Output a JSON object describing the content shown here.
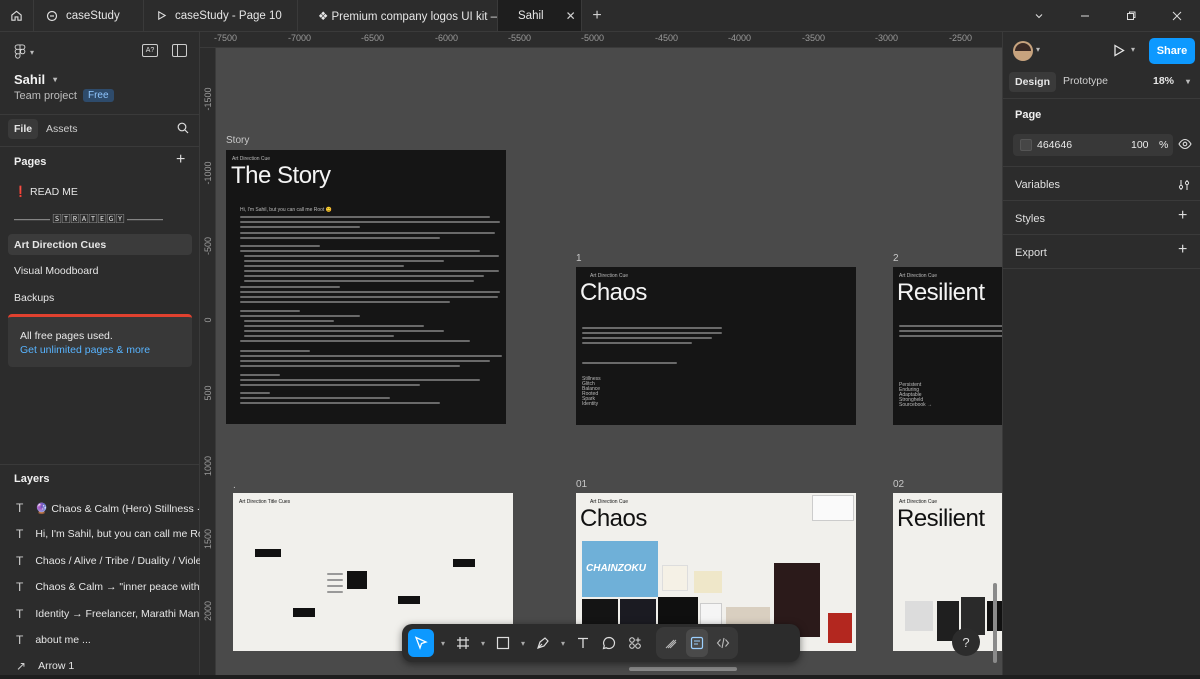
{
  "tabs": [
    {
      "label": "caseStudy",
      "icon": "figma-file-icon"
    },
    {
      "label": "caseStudy - Page 10",
      "icon": "play-icon"
    },
    {
      "label": "❖ Premium company logos UI kit – Un",
      "icon": "file-icon"
    },
    {
      "label": "Sahil",
      "icon": "file-icon",
      "close": "✕"
    }
  ],
  "left": {
    "project": "Sahil",
    "team": "Team project",
    "badge": "Free",
    "file_tab": "File",
    "assets_tab": "Assets",
    "pages_title": "Pages",
    "pages": [
      "❗ READ ME",
      "———— 🅂🅃🅁🄰🅃🄴🄶🅈 ————",
      "Art Direction Cues",
      "Visual Moodboard",
      "Backups"
    ],
    "banner_text": "All free pages used.",
    "banner_link": "Get unlimited pages & more",
    "layers_title": "Layers",
    "layers": [
      "🔮 Chaos & Calm (Hero) Stillness · Glit",
      "Hi, I'm Sahil, but you can call me Root",
      "Chaos / Alive / Tribe / Duality / Violenc",
      "Chaos & Calm → \"inner peace with cha",
      "Identity → Freelancer, Marathi Manus,",
      "about me ...",
      "Arrow 1"
    ]
  },
  "ruler": {
    "x": [
      "-7500",
      "-7000",
      "-6500",
      "-6000",
      "-5500",
      "-5000",
      "-4500",
      "-4000",
      "-3500",
      "-3000",
      "-2500"
    ],
    "y": [
      "-1500",
      "-1000",
      "-500",
      "0",
      "500",
      "1000",
      "1500",
      "2000"
    ]
  },
  "canvas": {
    "story_label": "Story",
    "cue": "Art Direction Cue",
    "story_title": "The Story",
    "greeting": "Hi, I'm Sahil, but you can call me Root 😊",
    "frame1_num": "1",
    "frame1_title": "Chaos",
    "frame2_num": "2",
    "frame2_title": "Resilient",
    "title_cues_label": "Art Direction Title Cues",
    "frame01_num": "01",
    "frame01_title": "Chaos",
    "frame02_num": "02",
    "frame02_title": "Resilient",
    "poster_text": "CHAINZOKU",
    "chaos_words": [
      "Stillness",
      "Glitch",
      "Balance",
      "Rooted",
      "Spark",
      "Identity"
    ],
    "resilient_words": [
      "Persistent",
      "Enduring",
      "Adaptable",
      "Strongheld",
      "Sourcebook →"
    ],
    "dot": "."
  },
  "right": {
    "share": "Share",
    "design_tab": "Design",
    "prototype_tab": "Prototype",
    "zoom": "18%",
    "page_title": "Page",
    "bg_color": "464646",
    "opacity": "100",
    "pct": "%",
    "variables": "Variables",
    "styles": "Styles",
    "export": "Export"
  },
  "help": "?",
  "colors": {
    "accent": "#0d99ff",
    "canvas": "#4a4a4a",
    "panel": "#2c2c2c"
  }
}
